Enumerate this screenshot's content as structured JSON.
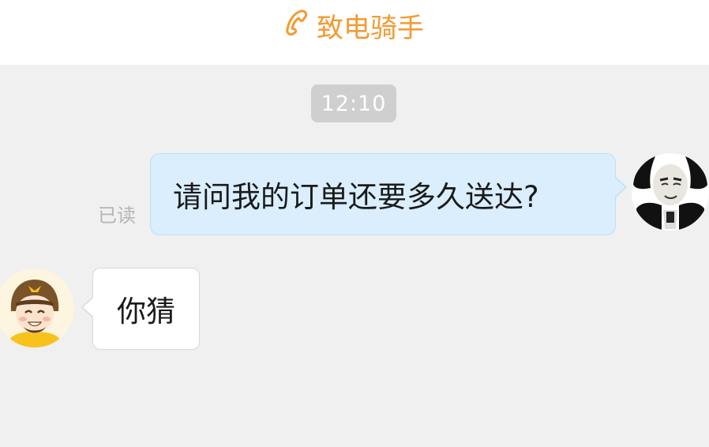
{
  "header": {
    "call_label": "致电骑手",
    "call_icon": "phone-icon",
    "accent_color": "#f39a30"
  },
  "chat": {
    "timestamp": "12:10",
    "messages": [
      {
        "sender": "me",
        "text": "请问我的订单还要多久送达?",
        "status": "已读",
        "avatar": "panda-meme-avatar"
      },
      {
        "sender": "rider",
        "text": "你猜",
        "avatar": "rider-avatar"
      }
    ]
  }
}
